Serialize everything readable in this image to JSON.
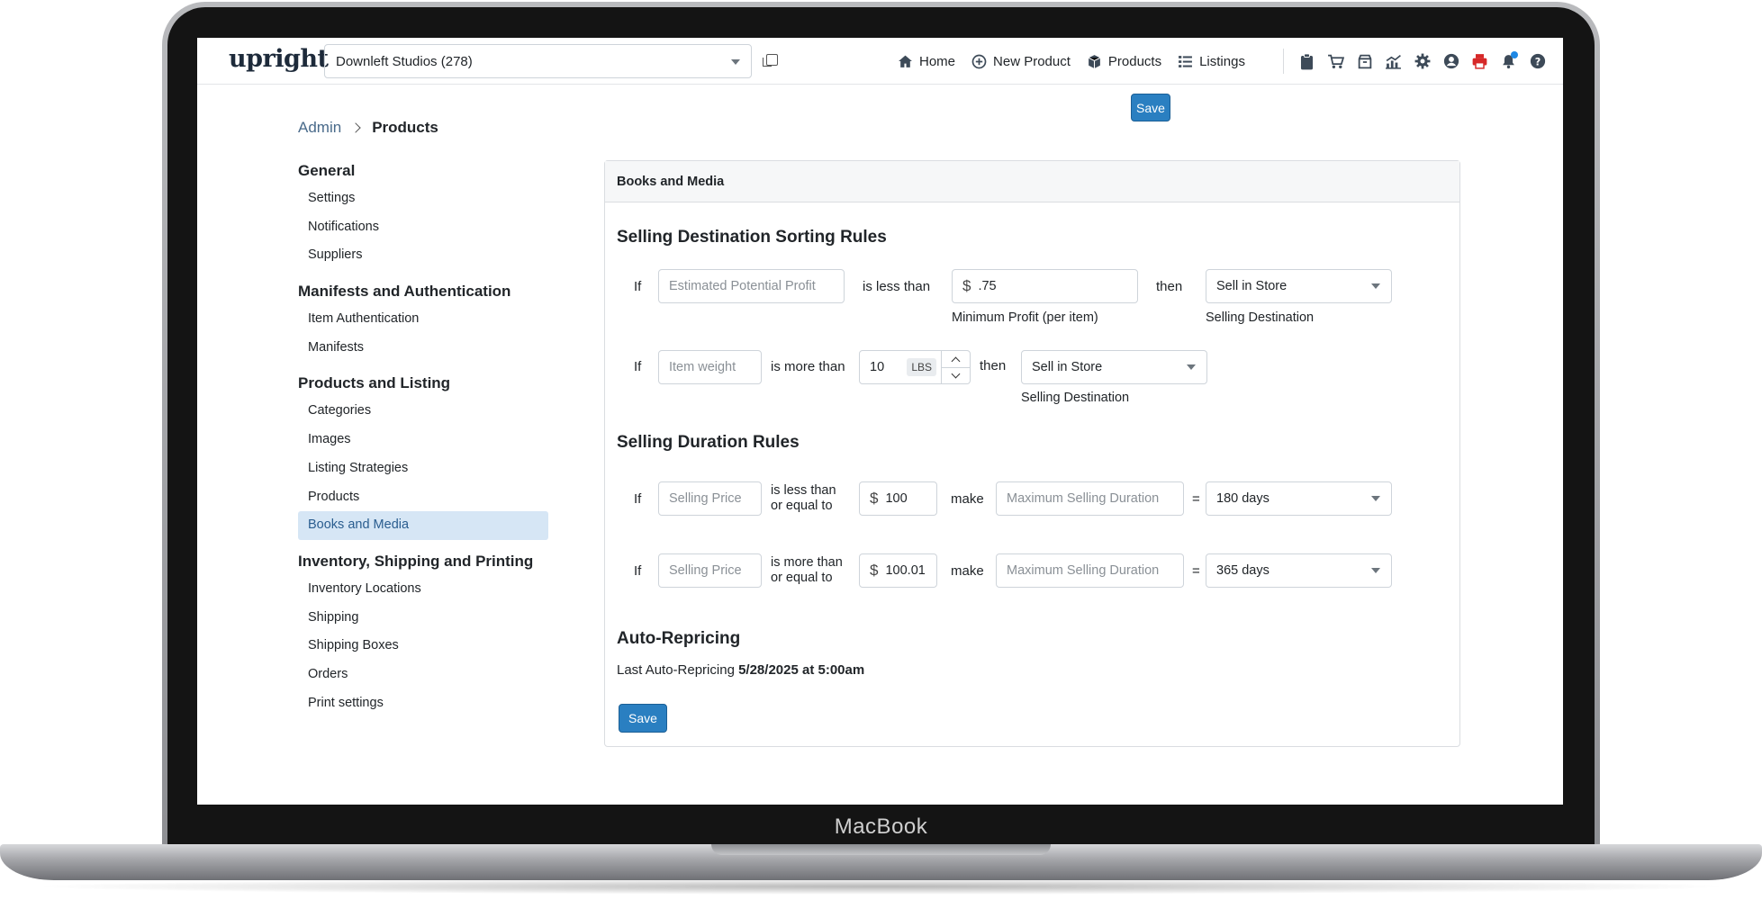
{
  "device_label": "MacBook",
  "navbar": {
    "logo": "upright",
    "store_select": "Downleft Studios (278)",
    "links": [
      {
        "label": "Home",
        "icon": "home-icon"
      },
      {
        "label": "New Product",
        "icon": "plus-circle-icon"
      },
      {
        "label": "Products",
        "icon": "box-icon"
      },
      {
        "label": "Listings",
        "icon": "list-icon"
      }
    ],
    "tools": [
      "clipboard-icon",
      "cart-icon",
      "archive-box-icon",
      "analytics-icon",
      "gear-icon",
      "user-circle-icon",
      "printer-icon",
      "bell-icon",
      "help-icon"
    ]
  },
  "breadcrumb": {
    "parent": "Admin",
    "current": "Products"
  },
  "save_label": "Save",
  "sidebar": [
    {
      "title": "General",
      "items": [
        "Settings",
        "Notifications",
        "Suppliers"
      ]
    },
    {
      "title": "Manifests and Authentication",
      "items": [
        "Item Authentication",
        "Manifests"
      ]
    },
    {
      "title": "Products and Listing",
      "items": [
        "Categories",
        "Images",
        "Listing Strategies",
        "Products",
        "Books and Media"
      ]
    },
    {
      "title": "Inventory, Shipping and Printing",
      "items": [
        "Inventory Locations",
        "Shipping",
        "Shipping Boxes",
        "Orders",
        "Print settings"
      ]
    }
  ],
  "active_item": "Books and Media",
  "card": {
    "header": "Books and Media",
    "destination": {
      "title": "Selling Destination Sorting Rules",
      "rule1": {
        "if": "If",
        "metric_placeholder": "Estimated Potential Profit",
        "op": "is less than",
        "currency": "$",
        "value": ".75",
        "value_caption": "Minimum Profit (per item)",
        "then": "then",
        "destination": "Sell in Store",
        "destination_caption": "Selling Destination"
      },
      "rule2": {
        "if": "If",
        "metric_placeholder": "Item weight",
        "op": "is more than",
        "value": "10",
        "unit": "LBS",
        "then": "then",
        "destination": "Sell in Store",
        "destination_caption": "Selling Destination"
      }
    },
    "duration": {
      "title": "Selling Duration Rules",
      "rule1": {
        "if": "If",
        "metric_placeholder": "Selling Price",
        "op_line1": "is less than",
        "op_line2": "or equal to",
        "currency": "$",
        "value": "100",
        "make": "make",
        "target_placeholder": "Maximum Selling Duration",
        "eq": "=",
        "duration": "180 days"
      },
      "rule2": {
        "if": "If",
        "metric_placeholder": "Selling Price",
        "op_line1": "is more than",
        "op_line2": "or equal to",
        "currency": "$",
        "value": "100.01",
        "make": "make",
        "target_placeholder": "Maximum Selling Duration",
        "eq": "=",
        "duration": "365 days"
      }
    },
    "repricing": {
      "title": "Auto-Repricing",
      "label": "Last Auto-Repricing",
      "value": "5/28/2025 at 5:00am"
    }
  }
}
